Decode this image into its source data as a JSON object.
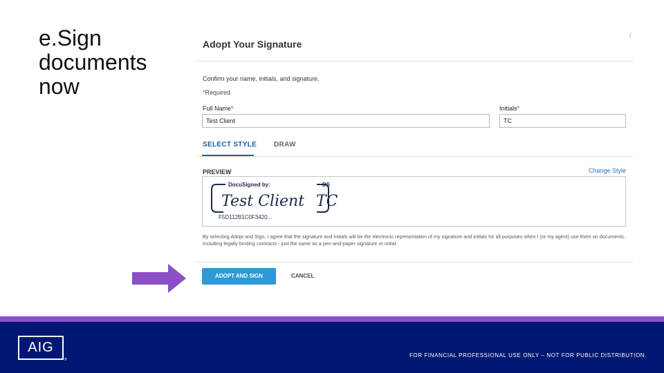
{
  "slide": {
    "title": "e.Sign\ndocuments\nnow"
  },
  "dialog": {
    "title": "Adopt Your Signature",
    "close_mark": "⁒",
    "confirm_text": "Confirm your name, initials, and signature.",
    "required_star": "*",
    "required_label": "Required",
    "full_name_label": "Full Name",
    "full_name_value": "Test Client",
    "initials_label": "Initials",
    "initials_value": "TC",
    "tabs": [
      {
        "label": "SELECT STYLE",
        "active": true
      },
      {
        "label": "DRAW",
        "active": false
      }
    ],
    "preview_label": "PREVIEW",
    "change_style": "Change Style",
    "signature": {
      "docusigned_by": "DocuSigned by:",
      "signature_text": "Test Client",
      "envelope_id": "F5D112B1C0F3420...",
      "initials_tag": "DS",
      "initials_text": "TC"
    },
    "legal_text": "By selecting Adopt and Sign, I agree that the signature and initials will be the electronic representation of my signature and initials for all purposes when I (or my agent) use them on documents, including legally binding contracts - just the same as a pen-and-paper signature or initial.",
    "adopt_button": "ADOPT AND SIGN",
    "cancel_button": "CANCEL"
  },
  "footer": {
    "logo_text": "AIG",
    "registered": "®",
    "disclaimer": "FOR FINANCIAL PROFESSIONAL USE ONLY – NOT FOR PUBLIC DISTRIBUTION."
  },
  "colors": {
    "accent_blue": "#2b9ad6",
    "tab_blue": "#1a5fa6",
    "arrow_purple": "#8c4fc7",
    "footer_navy": "#001871"
  },
  "icons": [
    "arrow-right-icon",
    "aig-logo"
  ]
}
